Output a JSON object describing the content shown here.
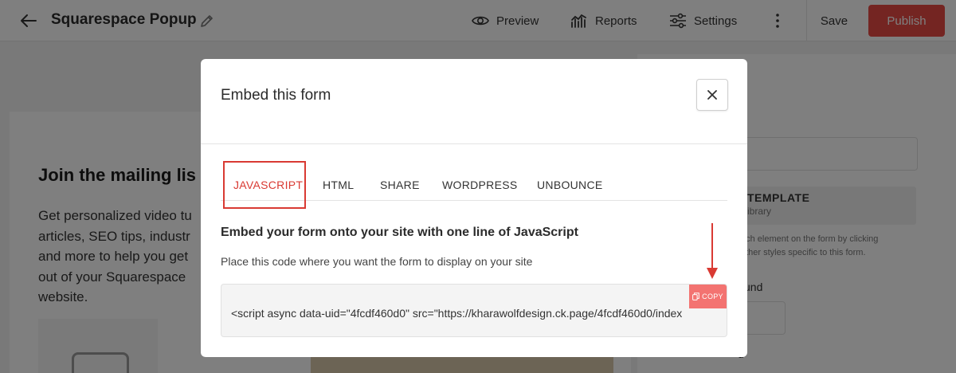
{
  "topbar": {
    "title": "Squarespace Popup",
    "preview_label": "Preview",
    "reports_label": "Reports",
    "settings_label": "Settings",
    "save_label": "Save",
    "publish_label": "Publish"
  },
  "background": {
    "heading": "Join the mailing lis",
    "paragraph": "Get personalized video tu\narticles, SEO tips, industr\nand more to help you get\nout of your Squarespace\nwebsite.",
    "side": {
      "template_title": "TEMPLATE",
      "template_sub": "ibrary",
      "text": "ach element on the form by clicking\n other styles specific to this form.",
      "label_und": "und",
      "label_bottom": "d"
    }
  },
  "modal": {
    "title": "Embed this form",
    "tabs": [
      {
        "label": "JAVASCRIPT"
      },
      {
        "label": "HTML"
      },
      {
        "label": "SHARE"
      },
      {
        "label": "WORDPRESS"
      },
      {
        "label": "UNBOUNCE"
      }
    ],
    "heading": "Embed your form onto your site with one line of JavaScript",
    "description": "Place this code where you want the form to display on your site",
    "code": "<script async data-uid=\"4fcdf460d0\" src=\"https://kharawolfdesign.ck.page/4fcdf460d0/index",
    "copy_label": "COPY"
  },
  "colors": {
    "accent": "#e84a45",
    "highlight": "#d93a33",
    "copy": "#f37371"
  }
}
